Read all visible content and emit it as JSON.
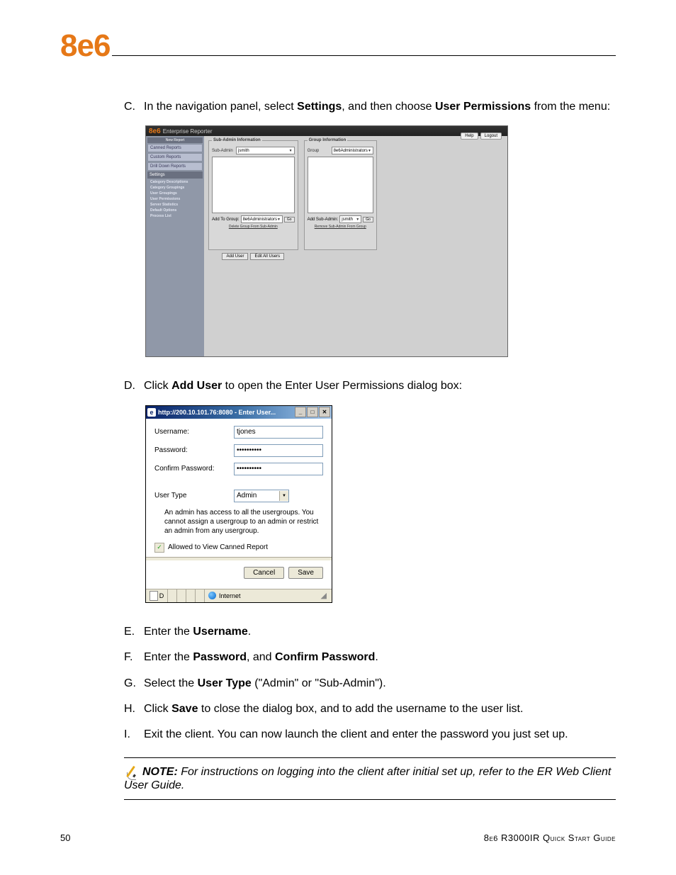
{
  "header": {
    "logo": "8e6"
  },
  "steps": {
    "c": {
      "letter": "C.",
      "pre": "In the navigation panel, select ",
      "b1": "Settings",
      "mid": ", and then choose ",
      "b2": "User Permissions",
      "post": " from the menu:"
    },
    "d": {
      "letter": "D.",
      "pre": "Click ",
      "b1": "Add User",
      "post": " to open the Enter User Permissions dialog box:"
    },
    "e": {
      "letter": "E.",
      "pre": "Enter the ",
      "b1": "Username",
      "post": "."
    },
    "f": {
      "letter": "F.",
      "pre": "Enter the ",
      "b1": "Password",
      "mid": ", and ",
      "b2": "Confirm Password",
      "post": "."
    },
    "g": {
      "letter": "G.",
      "pre": "Select the ",
      "b1": "User Type",
      "post": " (\"Admin\" or \"Sub-Admin\")."
    },
    "h": {
      "letter": "H.",
      "pre": "Click ",
      "b1": "Save",
      "post": " to close the dialog box, and to add the username to the user list."
    },
    "i": {
      "letter": "I.",
      "text": "Exit the client. You can now launch the client and enter the password you just set up."
    }
  },
  "screenshot1": {
    "logo": "8e6",
    "title": "Enterprise Reporter",
    "help": "Help",
    "logout": "Logout",
    "sidebar_header": "New Report",
    "nav": {
      "canned": "Canned Reports",
      "custom": "Custom Reports",
      "drill": "Drill Down Reports",
      "settings": "Settings"
    },
    "submenu": {
      "cat_desc": "Category Descriptions",
      "cat_group": "Category Groupings",
      "user_group": "User Groupings",
      "user_perm": "User Permissions",
      "server_stats": "Server Statistics",
      "default_opts": "Default Options",
      "process_list": "Process List"
    },
    "panel_left": {
      "title": "Sub-Admin Information",
      "label": "Sub-Admin",
      "value": "jsmith",
      "add_to_group_label": "Add To Group:",
      "add_to_group_value": "8e6Administrators",
      "go": "Go",
      "link": "Delete Group From Sub-Admin",
      "btn_add": "Add User",
      "btn_edit": "Edit All Users"
    },
    "panel_right": {
      "title": "Group Information",
      "label": "Group",
      "value": "8e6Administrators",
      "add_sub_label": "Add Sub-Admin:",
      "add_sub_value": "jsmith",
      "go": "Go",
      "link": "Remove Sub-Admin From Group"
    }
  },
  "screenshot2": {
    "title": "http://200.10.101.76:8080 - Enter User...",
    "fields": {
      "username_label": "Username:",
      "username_value": "tjones",
      "password_label": "Password:",
      "password_value": "••••••••••",
      "confirm_label": "Confirm Password:",
      "confirm_value": "••••••••••",
      "usertype_label": "User Type",
      "usertype_value": "Admin"
    },
    "desc": "An admin has access to all the usergroups. You cannot assign a usergroup to an admin or restrict an admin from any usergroup.",
    "checkbox": "Allowed to View Canned Report",
    "cancel": "Cancel",
    "save": "Save",
    "status_left": "D",
    "status_right": "Internet"
  },
  "note": {
    "label": "NOTE:",
    "text": " For instructions on logging into the client after initial set up, refer to the ER Web Client User Guide."
  },
  "footer": {
    "page": "50",
    "title_prefix": "8",
    "title_e6": "e6",
    "title_rest": " R3000IR Q",
    "title_uick": "uick",
    "title_s": " S",
    "title_tart": "tart",
    "title_g": " G",
    "title_uide": "uide"
  }
}
